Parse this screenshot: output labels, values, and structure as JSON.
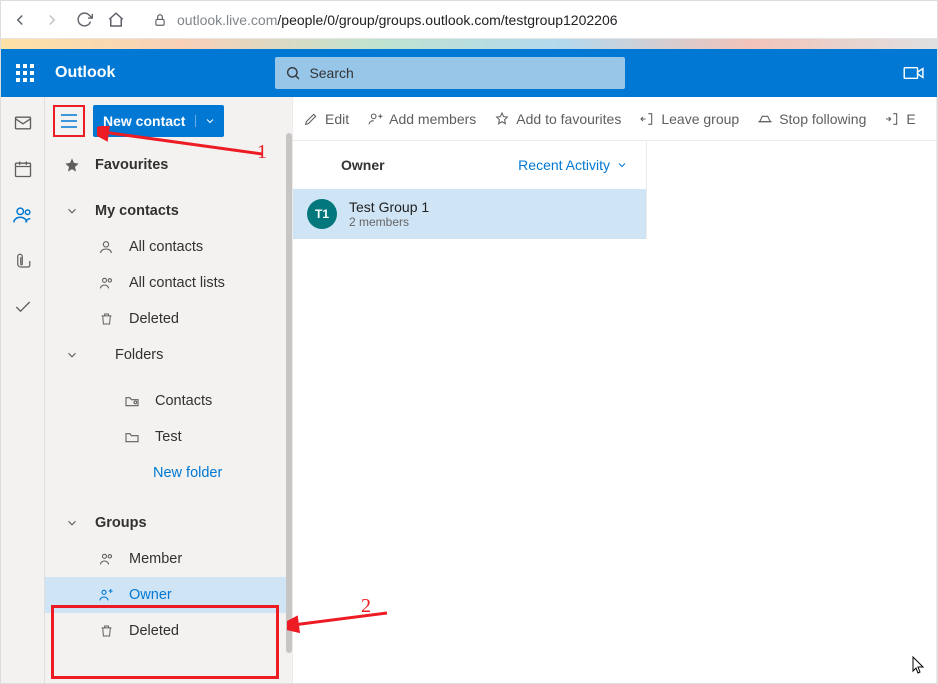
{
  "browser": {
    "url_host": "outlook.live.com",
    "url_path": "/people/0/group/groups.outlook.com/testgroup1202206"
  },
  "header": {
    "app": "Outlook",
    "search_placeholder": "Search"
  },
  "sidebar": {
    "new_button": "New contact",
    "favourites": "Favourites",
    "my_contacts": "My contacts",
    "all_contacts": "All contacts",
    "all_contact_lists": "All contact lists",
    "deleted": "Deleted",
    "folders": "Folders",
    "contacts_folder": "Contacts",
    "test_folder": "Test",
    "new_folder": "New folder",
    "groups": "Groups",
    "member": "Member",
    "owner": "Owner",
    "groups_deleted": "Deleted"
  },
  "toolbar": {
    "edit": "Edit",
    "add_members": "Add members",
    "add_fav": "Add to favourites",
    "leave": "Leave group",
    "stop": "Stop following",
    "email": "E"
  },
  "list": {
    "header_left": "Owner",
    "header_right": "Recent Activity",
    "item": {
      "initials": "T1",
      "title": "Test Group 1",
      "subtitle": "2 members"
    }
  },
  "annot": {
    "one": "1",
    "two": "2"
  }
}
